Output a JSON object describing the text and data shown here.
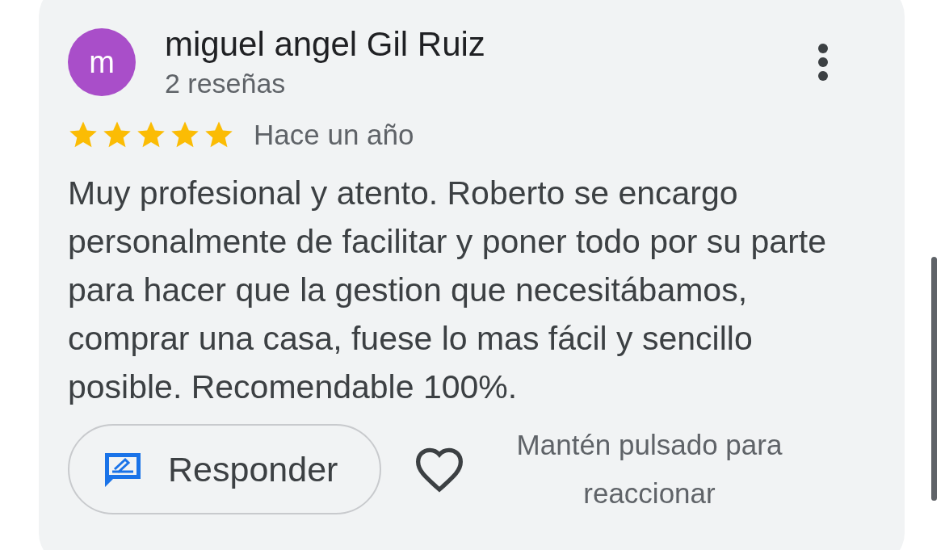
{
  "review": {
    "avatar_letter": "m",
    "author": "miguel angel Gil Ruiz",
    "review_count": "2 reseñas",
    "stars": 5,
    "time": "Hace un año",
    "text": "Muy profesional y atento. Roberto se encargo personalmente de facilitar y poner todo por su parte para hacer que la gestion que necesitábamos, comprar una casa, fuese lo mas fácil y sencillo posible. Recomendable 100%.",
    "reply_button": "Responder",
    "react_hint": "Mantén pulsado para reaccionar"
  }
}
